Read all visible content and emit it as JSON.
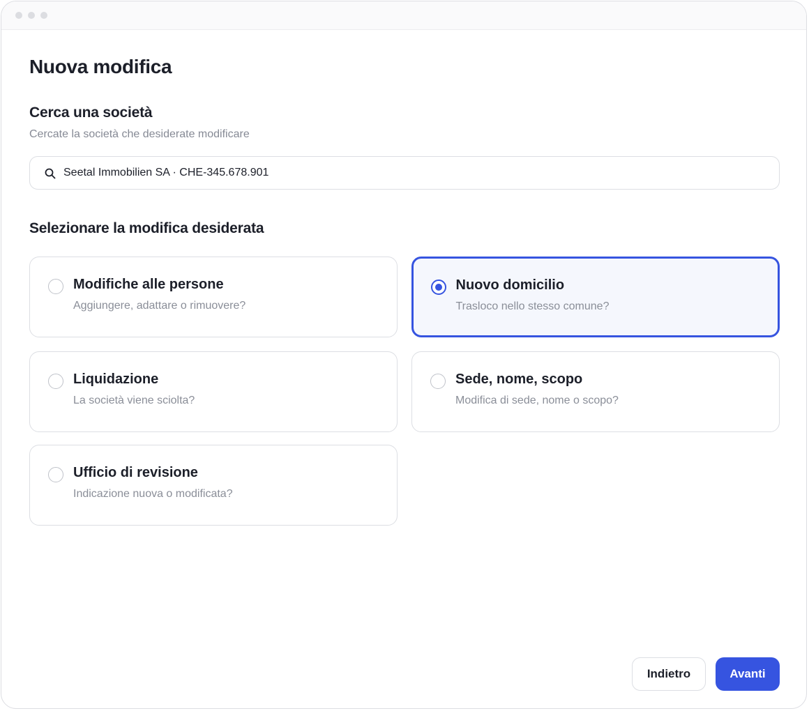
{
  "page": {
    "title": "Nuova modifica"
  },
  "search_section": {
    "title": "Cerca una società",
    "subtitle": "Cercate la società che desiderate modificare",
    "value": "Seetal Immobilien SA · CHE-345.678.901"
  },
  "options_section": {
    "title": "Selezionare la modifica desiderata",
    "options": [
      {
        "title": "Modifiche alle persone",
        "subtitle": "Aggiungere, adattare o rimuovere?",
        "selected": false
      },
      {
        "title": "Nuovo domicilio",
        "subtitle": "Trasloco nello stesso comune?",
        "selected": true
      },
      {
        "title": "Liquidazione",
        "subtitle": "La società viene sciolta?",
        "selected": false
      },
      {
        "title": "Sede, nome, scopo",
        "subtitle": "Modifica di sede, nome o scopo?",
        "selected": false
      },
      {
        "title": "Ufficio di revisione",
        "subtitle": "Indicazione nuova o modificata?",
        "selected": false
      }
    ]
  },
  "footer": {
    "back_label": "Indietro",
    "next_label": "Avanti"
  },
  "colors": {
    "accent": "#3654e0",
    "border": "#dcdee3",
    "muted_text": "#8a8e98"
  },
  "icons": {
    "search": "search-icon",
    "window_controls": "window-dot-icon"
  }
}
